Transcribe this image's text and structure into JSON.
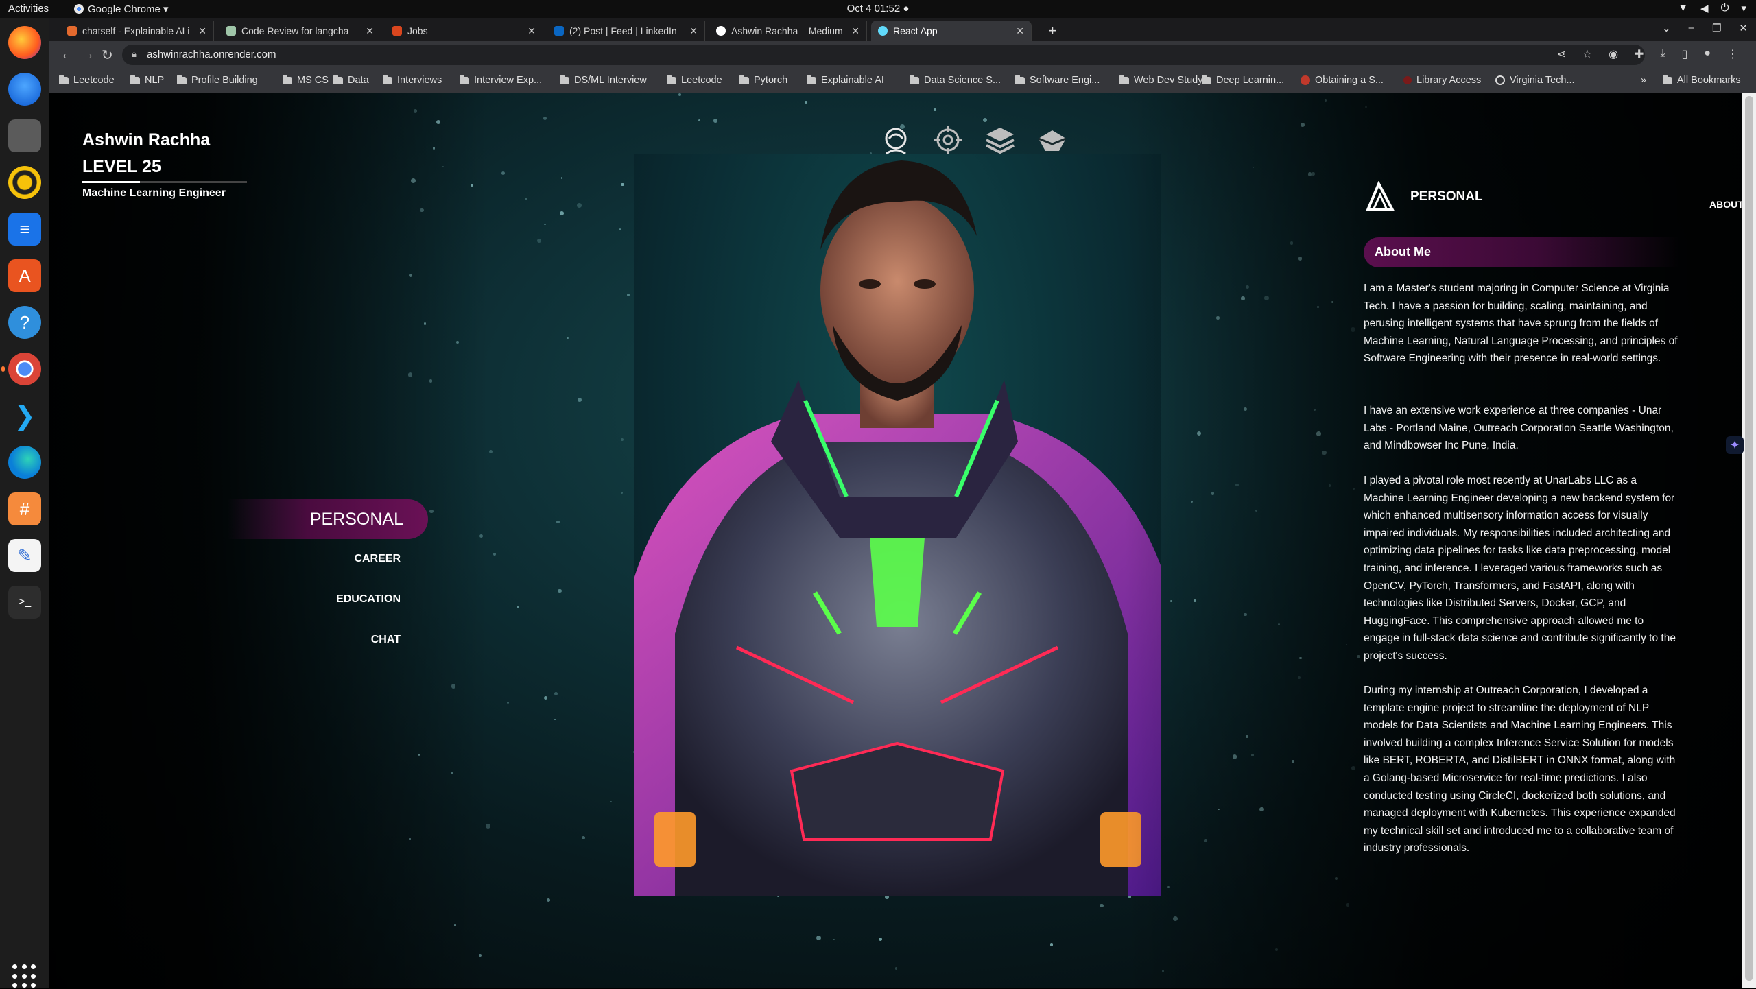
{
  "topbar": {
    "activities": "Activities",
    "app_menu": "Google Chrome ▾",
    "clock": "Oct 4  01:52  ●"
  },
  "dock": {
    "apps": [
      "firefox-icon",
      "thunderbird-icon",
      "files-icon",
      "rhythmbox-icon",
      "writer-icon",
      "app-center-icon",
      "help-icon",
      "chrome-icon",
      "vscode-icon",
      "edge-icon",
      "app-icon",
      "text-editor-icon",
      "terminal-icon"
    ]
  },
  "tabs": [
    {
      "title": "chatself - Explainable AI i",
      "favicon_color": "#e46a2e"
    },
    {
      "title": "Code Review for langcha",
      "favicon_color": "#9fc5a8"
    },
    {
      "title": "Jobs",
      "favicon_color": "#d9461e"
    },
    {
      "title": "(2) Post | Feed | LinkedIn",
      "favicon_color": "#0a66c2"
    },
    {
      "title": "Ashwin Rachha – Medium",
      "favicon_color": "#ffffff"
    },
    {
      "title": "React App",
      "favicon_color": "#61dafb",
      "active": true
    }
  ],
  "address_bar": {
    "url": "ashwinrachha.onrender.com"
  },
  "bookmarks": [
    "Leetcode",
    "NLP",
    "Profile Building",
    "MS CS",
    "Data",
    "Interviews",
    "Interview Exp...",
    "DS/ML Interview",
    "Leetcode",
    "Pytorch",
    "Explainable AI",
    "Data Science S...",
    "Software Engi...",
    "Web Dev Study",
    "Deep Learnin...",
    "Obtaining a S...",
    "Library Access",
    "Virginia Tech...",
    "All Bookmarks"
  ],
  "profile": {
    "name": "Ashwin Rachha",
    "level": "LEVEL 25",
    "role": "Machine Learning Engineer",
    "xp_progress": 0.35
  },
  "top_nav": {
    "items": [
      "about-icon",
      "skills-icon",
      "projects-icon",
      "contact-icon"
    ],
    "active_label": "ABOUT"
  },
  "side_nav": {
    "active": "PERSONAL",
    "items": [
      "CAREER",
      "EDUCATION",
      "CHAT"
    ]
  },
  "panel": {
    "heading": "PERSONAL",
    "section": "About Me",
    "paragraphs": [
      "I am a Master's student majoring in Computer Science at Virginia Tech. I have a passion for building, scaling, maintaining, and perusing intelligent systems that have sprung from the fields of Machine Learning, Natural Language Processing, and principles of Software Engineering with their presence in real-world settings.",
      "I have an extensive work experience at three companies - Unar Labs - Portland Maine, Outreach Corporation Seattle Washington, and Mindbowser Inc Pune, India.",
      "I played a pivotal role most recently at UnarLabs LLC as a Machine Learning Engineer developing a new backend system for which enhanced multisensory information access for visually impaired individuals. My responsibilities included architecting and optimizing data pipelines for tasks like data preprocessing, model training, and inference. I leveraged various frameworks such as OpenCV, PyTorch, Transformers, and FastAPI, along with technologies like Distributed Servers, Docker, GCP, and HuggingFace. This comprehensive approach allowed me to engage in full-stack data science and contribute significantly to the project's success.",
      "During my internship at Outreach Corporation, I developed a template engine project to streamline the deployment of NLP models for Data Scientists and Machine Learning Engineers. This involved building a complex Inference Service Solution for models like BERT, ROBERTA, and DistilBERT in ONNX format, along with a Golang-based Microservice for real-time predictions. I also conducted testing using CircleCI, dockerized both solutions, and managed deployment with Kubernetes. This experience expanded my technical skill set and introduced me to a collaborative team of industry professionals."
    ]
  },
  "colors": {
    "accent": "#5b0f4e",
    "background": "#0e3036"
  }
}
